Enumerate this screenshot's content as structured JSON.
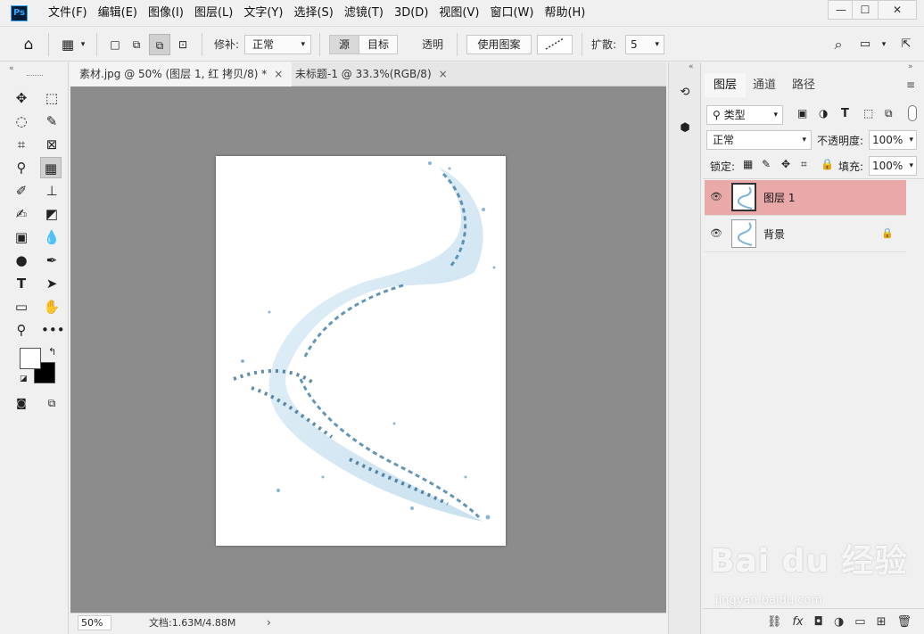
{
  "app": {
    "logo": "Ps"
  },
  "menu": [
    "文件(F)",
    "编辑(E)",
    "图像(I)",
    "图层(L)",
    "文字(Y)",
    "选择(S)",
    "滤镜(T)",
    "3D(D)",
    "视图(V)",
    "窗口(W)",
    "帮助(H)"
  ],
  "window_controls": {
    "minimize": "—",
    "maximize": "☐",
    "close": "✕"
  },
  "options": {
    "patch_label": "修补:",
    "patch_mode": "正常",
    "source": "源",
    "target": "目标",
    "transparent": "透明",
    "use_pattern": "使用图案",
    "diffusion_label": "扩散:",
    "diffusion_value": "5"
  },
  "tabs": [
    {
      "label": "素材.jpg @ 50% (图层 1, 红 拷贝/8) *",
      "close": "×"
    },
    {
      "label": "未标题-1 @ 33.3%(RGB/8)",
      "close": "×"
    }
  ],
  "status": {
    "zoom": "50%",
    "doc": "文档:1.63M/4.88M",
    "arrow": "›"
  },
  "panel": {
    "tabs": [
      "图层",
      "通道",
      "路径"
    ],
    "filter": "类型",
    "blend_mode": "正常",
    "opacity_label": "不透明度:",
    "opacity_value": "100%",
    "lock_label": "锁定:",
    "fill_label": "填充:",
    "fill_value": "100%",
    "layers": [
      {
        "name": "图层 1",
        "active": true
      },
      {
        "name": "背景",
        "locked": true
      }
    ]
  },
  "colors": {
    "accent": "#31a8ff",
    "active_layer": "#e9a9a9",
    "canvas_bg": "#8c8c8c"
  },
  "watermark": {
    "main": "Bai du 经验",
    "sub": "jingyan.baidu.com"
  }
}
